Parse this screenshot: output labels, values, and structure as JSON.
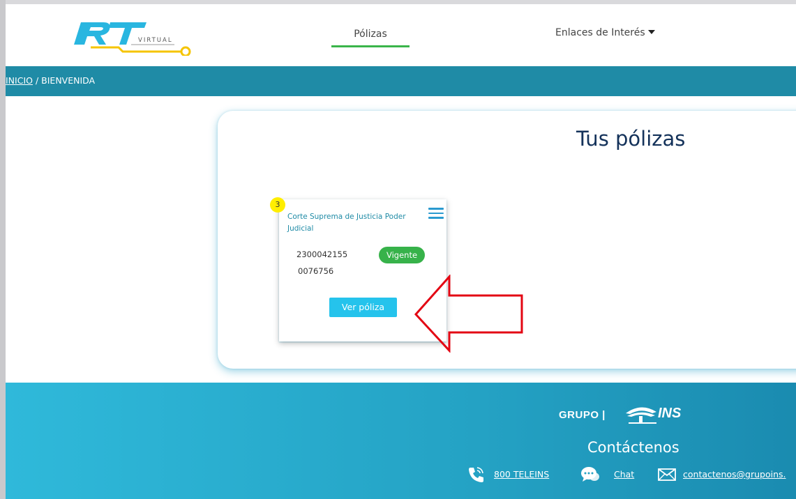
{
  "header": {
    "logo_text": "RT",
    "logo_subtext": "VIRTUAL",
    "nav_polizas": "Pólizas",
    "nav_enlaces": "Enlaces de Interés"
  },
  "breadcrumb": {
    "home": "INICIO",
    "separator": " / ",
    "current": "BIENVENIDA"
  },
  "main": {
    "title": "Tus pólizas",
    "policies": [
      {
        "badge": "3",
        "name": "Corte Suprema de Justicia Poder Judicial",
        "number_line1": "2300042155",
        "number_line2": "0076756",
        "status": "Vigente",
        "button": "Ver póliza"
      }
    ]
  },
  "footer": {
    "brand_grupo": "GRUPO |",
    "brand_ins": "INS",
    "contact_title": "Contáctenos",
    "phone": "800 TELEINS",
    "chat": "Chat",
    "email": "contactenos@grupoins."
  },
  "colors": {
    "teal_band": "#1f8ba6",
    "nav_active": "#3ab54a",
    "status_green": "#37b24a",
    "button_cyan": "#25c3ec",
    "badge_yellow": "#ffee00",
    "title_navy": "#14325a",
    "annotation_arrow": "#e30613"
  },
  "icons": [
    "menu-icon",
    "phone-icon",
    "chat-icon",
    "email-icon",
    "caret-down-icon",
    "tree-icon"
  ]
}
